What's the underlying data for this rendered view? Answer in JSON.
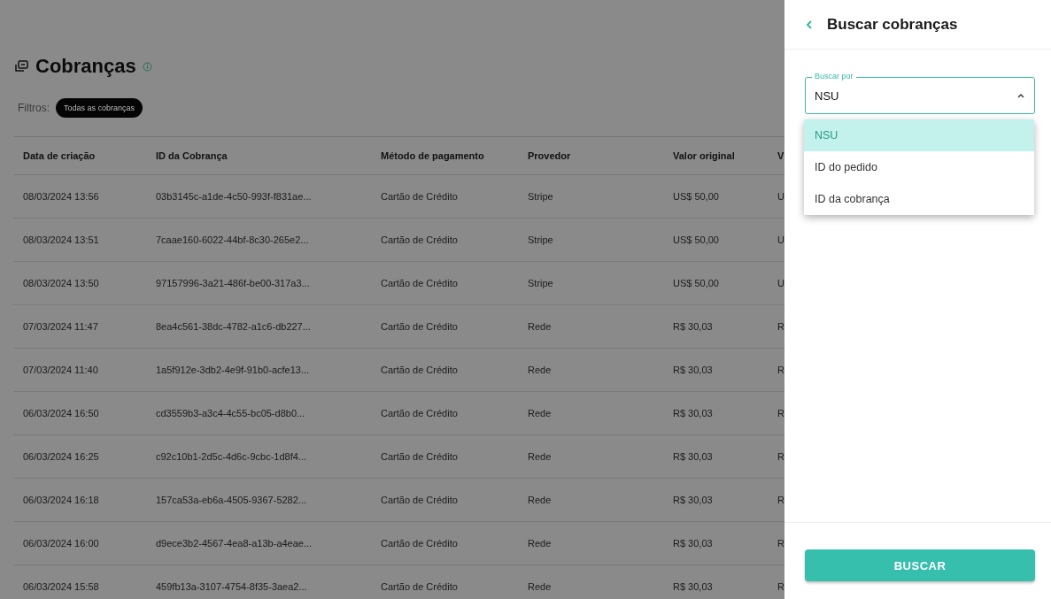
{
  "page": {
    "title": "Cobranças",
    "filters_label": "Filtros:",
    "filter_chip": "Todas as cobranças"
  },
  "table": {
    "columns": [
      "Data de criação",
      "ID da Cobrança",
      "Método de pagamento",
      "Provedor",
      "Valor original",
      "V"
    ],
    "rows": [
      [
        "08/03/2024 13:56",
        "03b3145c-a1de-4c50-993f-f831ae...",
        "Cartão de Crédito",
        "Stripe",
        "US$ 50,00",
        "U"
      ],
      [
        "08/03/2024 13:51",
        "7caae160-6022-44bf-8c30-265e2...",
        "Cartão de Crédito",
        "Stripe",
        "US$ 50,00",
        "U"
      ],
      [
        "08/03/2024 13:50",
        "97157996-3a21-486f-be00-317a3...",
        "Cartão de Crédito",
        "Stripe",
        "US$ 50,00",
        "U"
      ],
      [
        "07/03/2024 11:47",
        "8ea4c561-38dc-4782-a1c6-db227...",
        "Cartão de Crédito",
        "Rede",
        "R$ 30,03",
        "R"
      ],
      [
        "07/03/2024 11:40",
        "1a5f912e-3db2-4e9f-91b0-acfe13...",
        "Cartão de Crédito",
        "Rede",
        "R$ 30,03",
        "R"
      ],
      [
        "06/03/2024 16:50",
        "cd3559b3-a3c4-4c55-bc05-d8b0...",
        "Cartão de Crédito",
        "Rede",
        "R$ 30,03",
        "R"
      ],
      [
        "06/03/2024 16:25",
        "c92c10b1-2d5c-4d6c-9cbc-1d8f4...",
        "Cartão de Crédito",
        "Rede",
        "R$ 30,03",
        "R"
      ],
      [
        "06/03/2024 16:18",
        "157ca53a-eb6a-4505-9367-5282...",
        "Cartão de Crédito",
        "Rede",
        "R$ 30,03",
        "R"
      ],
      [
        "06/03/2024 16:00",
        "d9ece3b2-4567-4ea8-a13b-a4eae...",
        "Cartão de Crédito",
        "Rede",
        "R$ 30,03",
        "R"
      ],
      [
        "06/03/2024 15:58",
        "459fb13a-3107-4754-8f35-3aea2...",
        "Cartão de Crédito",
        "Rede",
        "R$ 30,03",
        "R"
      ]
    ]
  },
  "drawer": {
    "title": "Buscar cobranças",
    "select": {
      "label": "Buscar por",
      "value": "NSU",
      "expanded": true
    },
    "options": [
      {
        "label": "NSU",
        "selected": true
      },
      {
        "label": "ID do pedido",
        "selected": false
      },
      {
        "label": "ID da cobrança",
        "selected": false
      }
    ],
    "button": "BUSCAR"
  }
}
